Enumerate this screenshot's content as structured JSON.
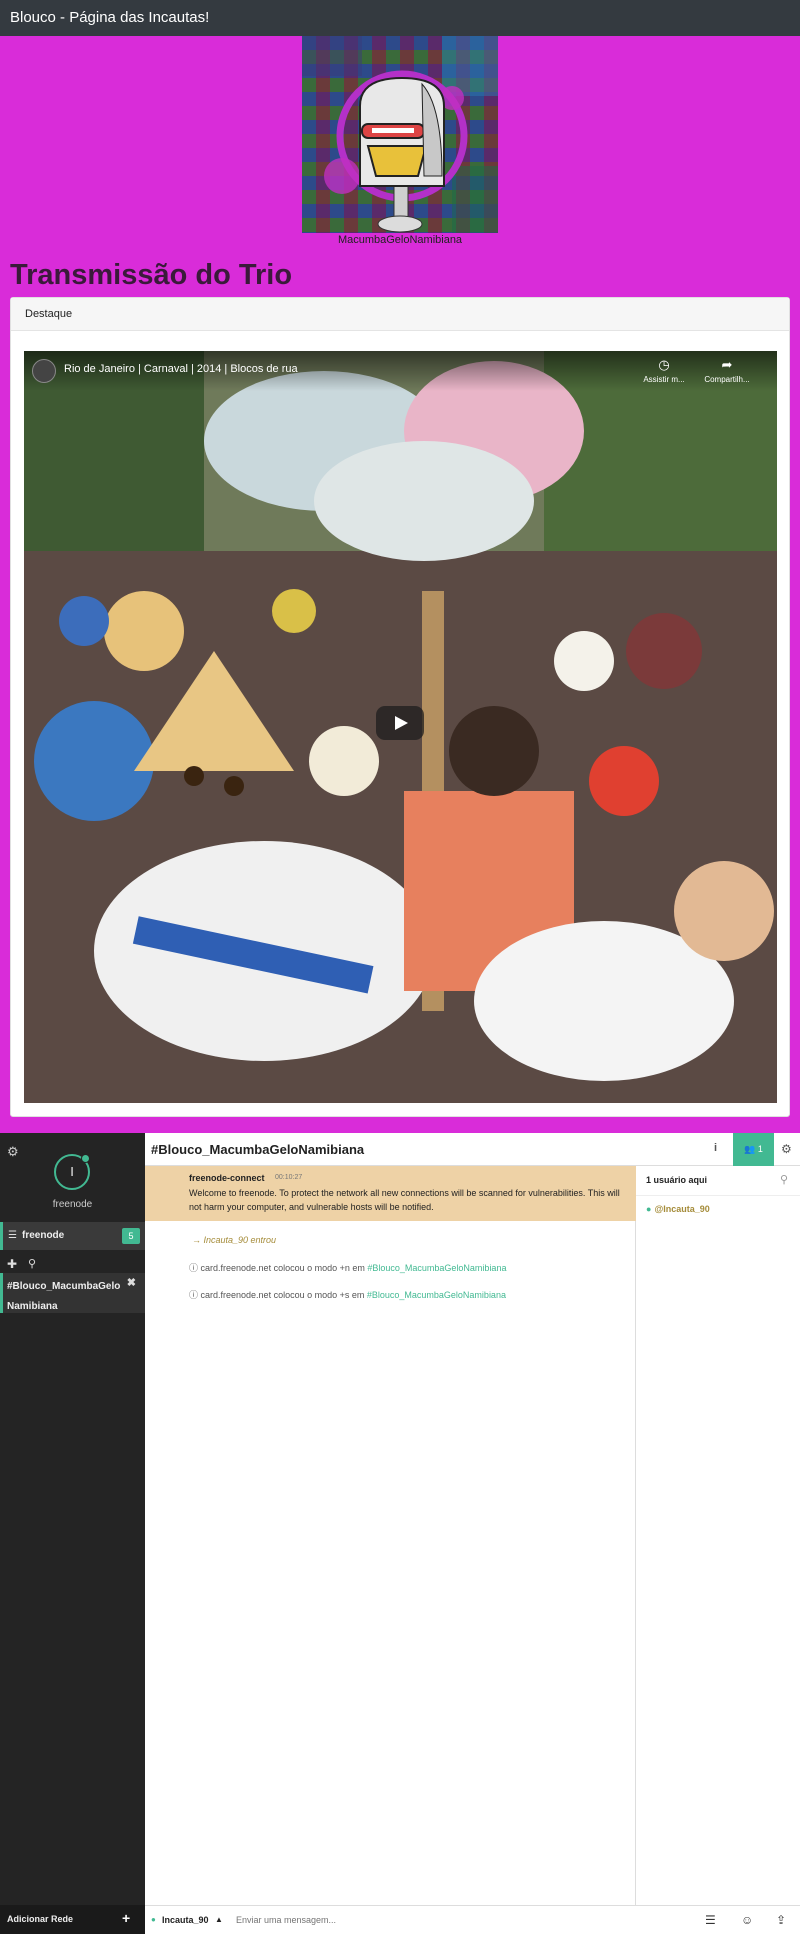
{
  "app": {
    "title": "Blouco - Página das Incautas!"
  },
  "logo": {
    "caption": "MacumbaGeloNamibiana"
  },
  "page": {
    "heading": "Transmissão do Trio"
  },
  "card": {
    "header": "Destaque"
  },
  "video": {
    "title": "Rio de Janeiro | Carnaval | 2014 | Blocos de rua",
    "watch_later_label": "Assistir m...",
    "share_label": "Compartilh..."
  },
  "irc": {
    "network": {
      "initial": "I",
      "name": "freenode",
      "unread_count": "5"
    },
    "active_channel": "#Blouco_MacumbaGeloNamibiana",
    "channel_list": [
      {
        "line1": "#Blouco_MacumbaGelo",
        "line2": "Namibiana"
      }
    ],
    "add_network_label": "Adicionar Rede",
    "member_count": "1",
    "messages": {
      "motd": {
        "nick": "freenode-connect",
        "time": "00:10:27",
        "text": "Welcome to freenode. To protect the network all new connections will be scanned for vulnerabilities. This will not harm your computer, and vulnerable hosts will be notified."
      },
      "join": "→ Incauta_90 entrou",
      "modes": [
        {
          "prefix": "card.freenode.net colocou o modo +n em ",
          "channel": "#Blouco_MacumbaGeloNamibiana"
        },
        {
          "prefix": "card.freenode.net colocou o modo +s em ",
          "channel": "#Blouco_MacumbaGeloNamibiana"
        }
      ]
    },
    "userlist": {
      "header": "1 usuário aqui",
      "users": [
        "@Incauta_90"
      ]
    },
    "input": {
      "nick": "Incauta_90",
      "placeholder": "Enviar uma mensagem..."
    }
  },
  "colors": {
    "page_bg": "#d92cd9",
    "topbar": "#343a40",
    "accent": "#42b992",
    "motd_bg": "#eed2a6",
    "sidebar": "#242424"
  },
  "icons": [
    "gear-icon",
    "list-icon",
    "plus-icon",
    "search-icon",
    "close-icon",
    "info-icon",
    "users-icon",
    "clock-icon",
    "share-icon",
    "play-icon",
    "menu-icon",
    "emoji-icon",
    "upload-icon",
    "caret-up-icon"
  ]
}
